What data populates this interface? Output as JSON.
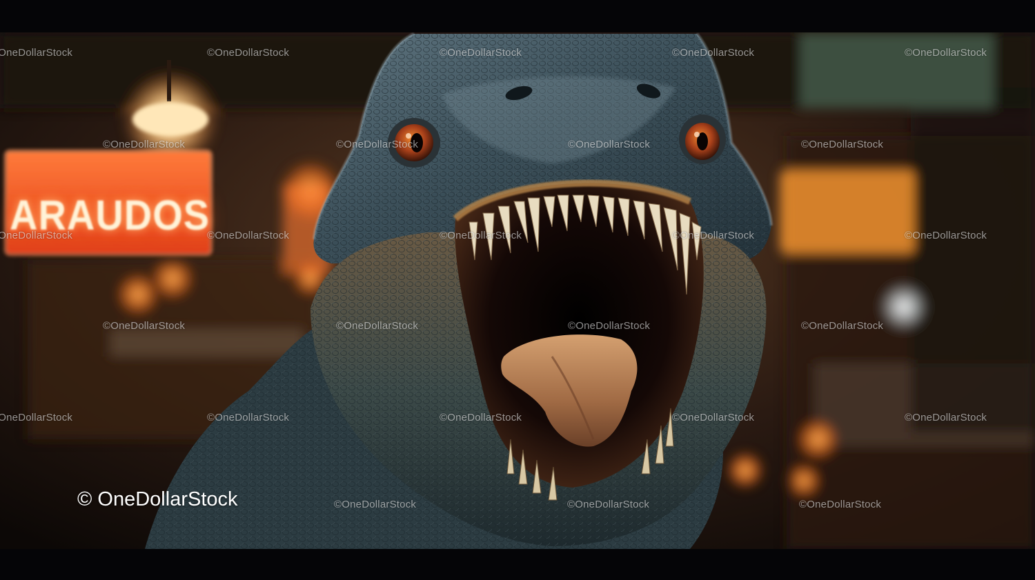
{
  "image": {
    "subject": "dinosaur-open-mouth",
    "background": "blurred-neon-store-interior"
  },
  "sign": {
    "text": "ARAUDOS"
  },
  "watermark": {
    "logo_text": "© OneDollarStock",
    "tile_text": "©OneDollarStock"
  },
  "colors": {
    "letterbox": "#050507",
    "neon_orange": "#ff6a2a",
    "dino_skin": "#3f5560",
    "mouth_interior": "#140806",
    "tongue": "#b07a52",
    "eye_amber": "#c2501a"
  }
}
